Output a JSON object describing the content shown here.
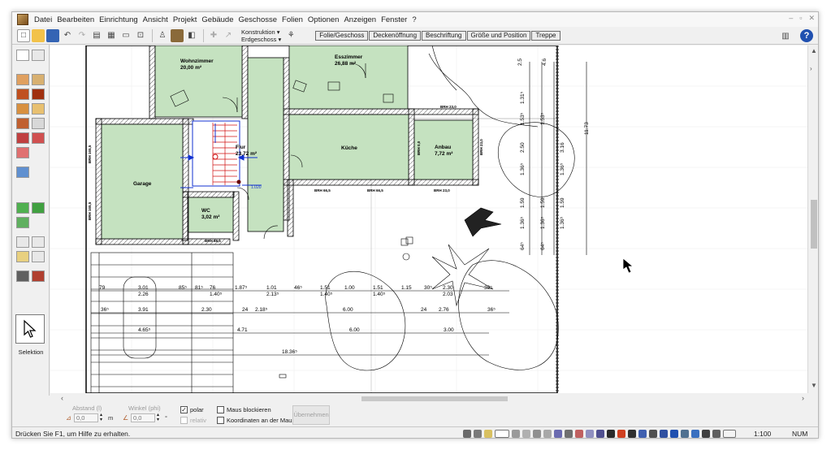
{
  "menu": [
    "Datei",
    "Bearbeiten",
    "Einrichtung",
    "Ansicht",
    "Projekt",
    "Gebäude",
    "Geschosse",
    "Folien",
    "Optionen",
    "Anzeigen",
    "Fenster",
    "?"
  ],
  "toolbar": {
    "layer_label": "Konstruktion ▾",
    "floor_label": "Erdgeschoss ▾",
    "tabs": [
      "Folie/Geschoss",
      "Deckenöffnung",
      "Beschriftung",
      "Größe und Position",
      "Treppe"
    ]
  },
  "palette": {
    "selection_label": "Selektion"
  },
  "rooms": [
    {
      "name": "Wohnzimmer",
      "area": "20,00 m²"
    },
    {
      "name": "Esszimmer",
      "area": "26,88 m²"
    },
    {
      "name": "Garage",
      "area": ""
    },
    {
      "name": "Flur",
      "area": "23,72 m²"
    },
    {
      "name": "Küche",
      "area": ""
    },
    {
      "name": "Anbau",
      "area": "7,72 m²"
    },
    {
      "name": "WC",
      "area": "3,02 m²"
    }
  ],
  "window_labels": [
    "BRH 23,0",
    "BRH 66,5",
    "BRH 66,5",
    "BRH 23,0",
    "BRH 88,5",
    "BRH 165,5",
    "BRH 165,5",
    "BRH 0,0",
    "BRH 23,0"
  ],
  "stair_label": "1.020",
  "dimensions": {
    "row1": [
      "79",
      "3.01",
      "85⁵",
      "81⁵",
      "76",
      "1.87⁵",
      "1.01",
      "46⁵",
      "1.51",
      "1.00",
      "1.51",
      "1.15",
      "30⁵",
      "2.30",
      "39⁵"
    ],
    "row1_sub": [
      "2.26",
      "1.40⁵",
      "2.13⁵",
      "1.40⁵",
      "1.40⁵",
      "2.03"
    ],
    "row2": [
      "36⁵",
      "3.91",
      "2.30",
      "24",
      "2.18⁵",
      "6.00",
      "24",
      "2.76",
      "36⁵"
    ],
    "row3": [
      "4.65⁵",
      "4.71",
      "6.00",
      "3.00"
    ],
    "row4": [
      "18.36⁵"
    ],
    "vertical": [
      "2.5",
      "4.6",
      "1.31⁵",
      "1.53⁵",
      "1.53⁵",
      "11.73",
      "2.50",
      "3.16",
      "1.36⁵",
      "1.36⁵",
      "1.59",
      "1.59",
      "1.59",
      "1.36⁵",
      "1.36⁵",
      "1.36⁵",
      "64⁵",
      "64⁵"
    ]
  },
  "inputbar": {
    "abstand_label": "Abstand (l)",
    "abstand_value": "0,0",
    "abstand_unit": "m",
    "winkel_label": "Winkel (phi)",
    "winkel_value": "0,0",
    "winkel_unit": "°",
    "polar_label": "polar",
    "relativ_label": "relativ",
    "maus_label": "Maus blockieren",
    "koord_label": "Koordinaten an der Maus",
    "apply_label": "Übernehmen"
  },
  "status": {
    "help_text": "Drücken Sie F1, um Hilfe zu erhalten.",
    "scale": "1:100",
    "num": "NUM"
  },
  "colors": {
    "room_fill": "#c5e2c0",
    "dim_blue": "#1030d0",
    "stair_red": "#d01010"
  }
}
